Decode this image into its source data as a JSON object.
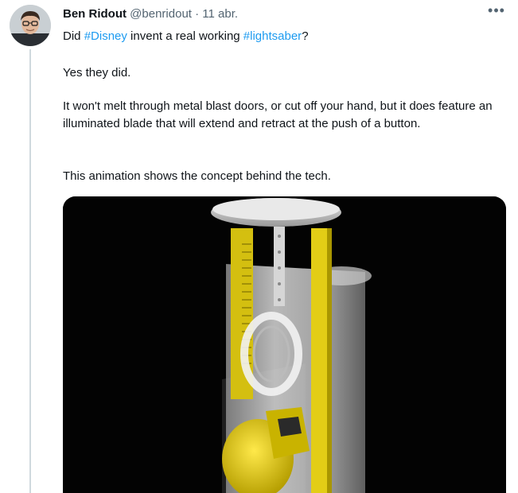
{
  "tweet": {
    "author_name": "Ben Ridout",
    "handle": "@benridout",
    "separator": "·",
    "date": "11 abr.",
    "more_icon": "more-horizontal-icon",
    "text": {
      "line1_prefix": "Did ",
      "hashtag_disney": "#Disney",
      "line1_middle": " invent a real working ",
      "hashtag_lightsaber": "#lightsaber",
      "line1_suffix": "?",
      "paragraph2": "Yes they did.",
      "paragraph3": "It won't melt through metal blast doors, or cut off your hand, but it does feature an illuminated blade that will extend and retract at the push of a button.",
      "paragraph4": "This animation shows the concept behind the tech."
    },
    "media": {
      "type": "video-still",
      "background_color": "#030303",
      "accent_color": "#e8d21a"
    },
    "colors": {
      "hashtag": "#1d9bf0",
      "secondary_text": "#536471"
    }
  }
}
